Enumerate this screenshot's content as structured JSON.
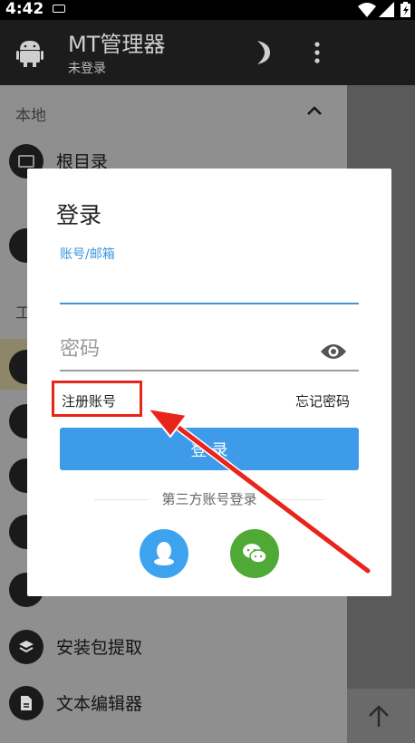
{
  "status_bar": {
    "time": "4:42"
  },
  "app_bar": {
    "title": "MT管理器",
    "subtitle": "未登录"
  },
  "drawer": {
    "section_local": "本地",
    "section_tools_partial": "工",
    "items": [
      {
        "label": "根目录",
        "icon": "folder-icon"
      },
      {
        "label": "安装包提取",
        "icon": "layers-icon"
      },
      {
        "label": "文本编辑器",
        "icon": "document-icon"
      }
    ]
  },
  "login_dialog": {
    "title": "登录",
    "account_label": "账号/邮箱",
    "account_value": "",
    "password_placeholder": "密码",
    "register_link": "注册账号",
    "forgot_link": "忘记密码",
    "login_button": "登 录",
    "third_party_label": "第三方账号登录"
  },
  "colors": {
    "accent": "#3d9be9",
    "qq": "#3ea3ef",
    "wechat": "#4ea935",
    "annotation": "#e8241b"
  }
}
